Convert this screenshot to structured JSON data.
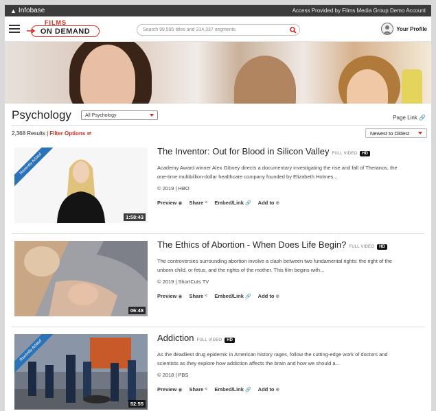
{
  "topbar": {
    "brand": "Infobase",
    "access_text": "Access Provided by Films Media Group Demo Account"
  },
  "header": {
    "logo_top": "FILMS",
    "logo_main": "ON DEMAND",
    "search_placeholder": "Search 98,595 titles and 314,337 segments",
    "profile_label": "Your Profile"
  },
  "category": {
    "title": "Psychology",
    "filter_select": "All Psychology",
    "page_link": "Page Link"
  },
  "results": {
    "count": "2,368 Results |",
    "filter_options": "Filter Options",
    "sort": "Newest to Oldest"
  },
  "videos": [
    {
      "title": "The Inventor: Out for Blood in Silicon Valley",
      "full_video": "FULL VIDEO",
      "hd": "HD",
      "desc1": "Academy Award winner Alex Gibney directs a documentary investigating the rise and fall of Theranos, the",
      "desc2": "one-time multibillion-dollar healthcare company founded by Elizabeth Holmes...",
      "meta": "© 2019 | HBO",
      "duration": "1:58:43",
      "ribbon": "Recently Added"
    },
    {
      "title": "The Ethics of Abortion - When Does Life Begin?",
      "full_video": "FULL VIDEO",
      "hd": "HD",
      "desc1": "The controversies surrounding abortion involve a clash between two fundamental rights: the right of the",
      "desc2": "unborn child, or fetus, and the rights of the mother. This film begins with...",
      "meta": "© 2019 | ShortCuts TV",
      "duration": "06:48",
      "ribbon": ""
    },
    {
      "title": "Addiction",
      "full_video": "FULL VIDEO",
      "hd": "HD",
      "desc1": "As the deadliest drug epidemic in American history rages, follow the cutting-edge work of doctors and",
      "desc2": "scientists as they explore how addiction affects the brain and how we should a...",
      "meta": "© 2018 | PBS",
      "duration": "52:55",
      "ribbon": "Recently Added"
    }
  ],
  "actions": {
    "preview": "Preview",
    "share": "Share",
    "embed": "Embed/Link",
    "add": "Add to"
  },
  "colors": {
    "accent_red": "#c82a1e",
    "topbar": "#3c3c3c",
    "ribbon_blue": "#2a73b8"
  }
}
